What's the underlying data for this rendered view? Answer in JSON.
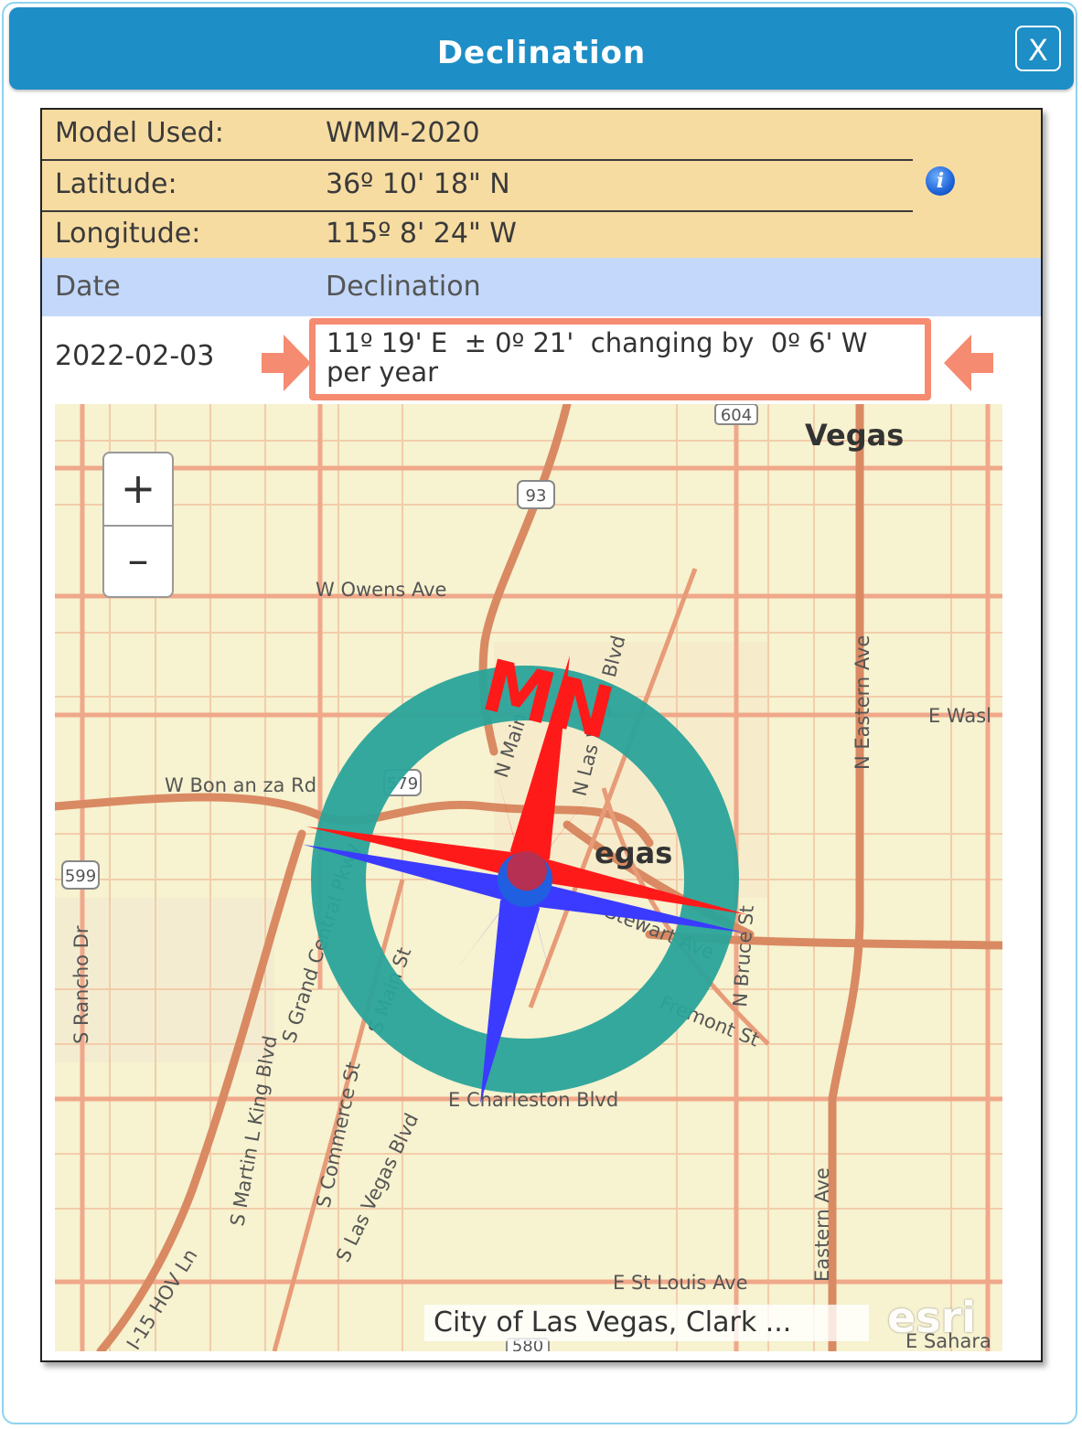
{
  "dialog": {
    "title": "Declination",
    "close_label": "X"
  },
  "info": {
    "model_label": "Model Used:",
    "model_value": "WMM-2020",
    "latitude_label": "Latitude:",
    "latitude_value": "36º 10' 18\" N",
    "longitude_label": "Longitude:",
    "longitude_value": "115º 8' 24\" W",
    "info_icon": "info-icon"
  },
  "table": {
    "headers": [
      "Date",
      "Declination"
    ],
    "rows": [
      {
        "date": "2022-02-03",
        "declination": "11º 19' E  ± 0º 21'  changing by  0º 6' W\nper year"
      }
    ]
  },
  "map": {
    "zoom_in_label": "+",
    "zoom_out_label": "–",
    "compass_label": "MN",
    "declination_degrees": 11.3,
    "labels": {
      "north_las_vegas": "North Las",
      "vegas_top": "Vegas",
      "owens": "W Owens Ave",
      "bonanza": "W Bon an za Rd",
      "charleston": "E Charleston Blvd",
      "st_louis": "E St Louis Ave",
      "rancho": "S Rancho Dr",
      "eastern": "N Eastern Ave",
      "eastern_s": "Eastern Ave",
      "mlk": "S Martin L King Blvd",
      "grand_central": "S Grand Central Pkwy",
      "commerce": "S Commerce St",
      "las_vegas_blvd": "S Las Vegas Blvd",
      "hov": "I-15 HOV Ln",
      "fremont": "Fremont St",
      "bruce": "N Bruce St",
      "washington": "E Wasl",
      "sahara": "E Sahara",
      "stewart": "Stewart Ave",
      "main": "S Main St",
      "main_n": "N Main",
      "lv_blvd_n": "N Las Vegas Blvd",
      "city_center": "egas",
      "vegas_n": "Vegas",
      "shield_93": "93",
      "shield_599": "599",
      "shield_579": "579",
      "shield_604": "604",
      "shield_580": "580"
    },
    "attribution": "City of Las Vegas, Clark ...",
    "logo_text": "esri"
  },
  "colors": {
    "title_bar": "#1e8ec6",
    "info_bg": "#f7dca1",
    "header_bg": "#c3d8fa",
    "highlight": "#f58b70",
    "compass_ring": "#2aa39a",
    "north_red": "#ff1a1a",
    "south_blue": "#3b3bff"
  }
}
